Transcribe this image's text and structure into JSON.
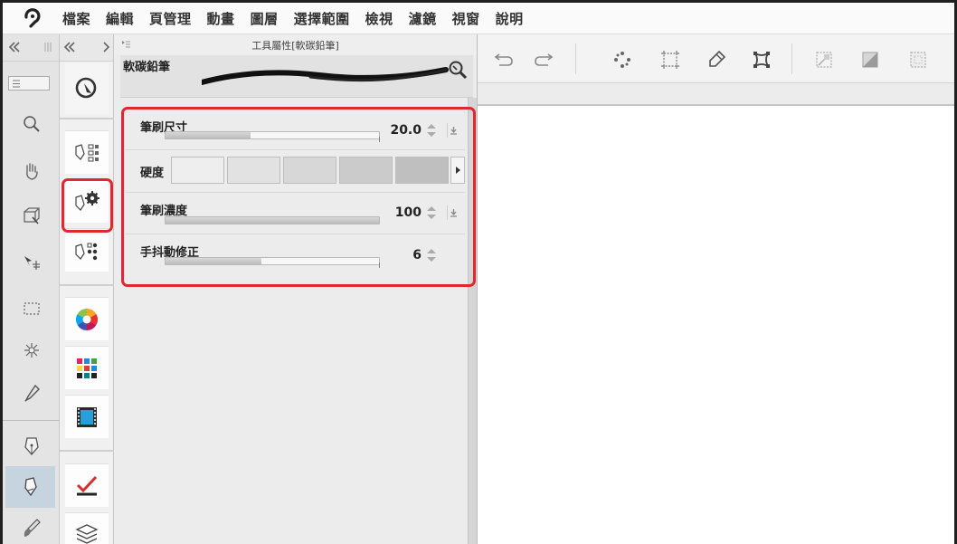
{
  "menu": {
    "items": [
      "檔案",
      "編輯",
      "頁管理",
      "動畫",
      "圖層",
      "選擇範圍",
      "檢視",
      "濾鏡",
      "視窗",
      "說明"
    ]
  },
  "tool_strip": {
    "tools": [
      "zoom-icon",
      "hand-icon",
      "object-select-icon",
      "move-layer-icon",
      "selection-rect-icon",
      "auto-select-wand-icon",
      "eyedropper-icon",
      "pen-icon",
      "pencil-icon",
      "brush-icon"
    ],
    "selected": "pencil-icon"
  },
  "subtool_column": {
    "buttons": [
      "tool-navigator-icon",
      "sub-tool-icon",
      "tool-property-icon",
      "sub-tool-detail-icon",
      "color-wheel-icon",
      "color-set-icon",
      "animation-cel-icon",
      "layer-property-icon",
      "layer-icon"
    ],
    "highlighted": "tool-property-icon"
  },
  "tool_property": {
    "panel_title": "工具屬性[軟碳鉛筆]",
    "brush_name": "軟碳鉛筆",
    "brush_size": {
      "label": "筆刷尺寸",
      "value": "20.0",
      "fill": 0.4
    },
    "hardness": {
      "label": "硬度",
      "levels": 5,
      "selected_level": 5
    },
    "brush_density": {
      "label": "筆刷濃度",
      "value": "100",
      "fill": 1.0
    },
    "stabilization": {
      "label": "手抖動修正",
      "value": "6",
      "fill": 0.45
    }
  },
  "command_bar": {
    "buttons": [
      "undo-icon",
      "redo-icon",
      "deselect-icon",
      "crop-icon",
      "draw-on-selection-icon",
      "transform-icon",
      "clear-outside-icon",
      "fill-icon",
      "select-all-icon"
    ]
  },
  "colors": {
    "highlight": "#e0282e",
    "selected_tool_bg": "#c6d4e0",
    "panel_bg": "#ececec"
  }
}
